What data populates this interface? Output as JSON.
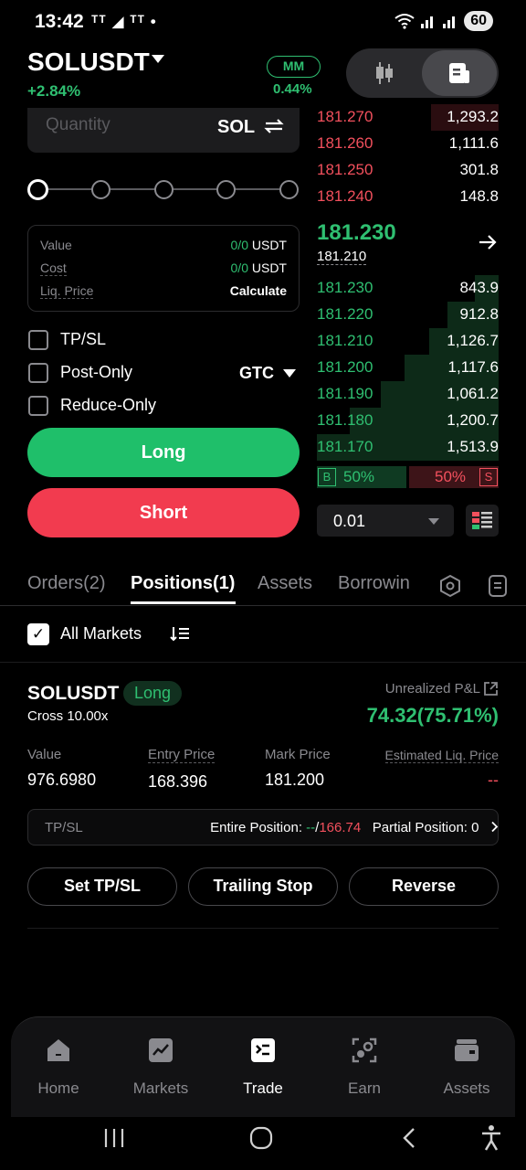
{
  "status_bar": {
    "time": "13:42",
    "apps": "ᵀᵀ ◢ ᵀᵀ •",
    "battery": "60"
  },
  "header": {
    "pair": "SOLUSDT",
    "change": "+2.84%",
    "mm_label": "MM",
    "mm_value": "0.44%"
  },
  "order_form": {
    "quantity_placeholder": "Quantity",
    "quantity_unit": "SOL",
    "value_label": "Value",
    "value": "0/0",
    "value_unit": "USDT",
    "cost_label": "Cost",
    "cost": "0/0",
    "cost_unit": "USDT",
    "liq_label": "Liq. Price",
    "liq_value": "Calculate",
    "tpsl_label": "TP/SL",
    "post_only_label": "Post-Only",
    "reduce_only_label": "Reduce-Only",
    "tif": "GTC",
    "long_label": "Long",
    "short_label": "Short"
  },
  "order_book": {
    "asks": [
      {
        "price": "181.270",
        "qty": "1,293.2",
        "depth": 0.37
      },
      {
        "price": "181.260",
        "qty": "1,111.6",
        "depth": 0.0
      },
      {
        "price": "181.250",
        "qty": "301.8",
        "depth": 0.0
      },
      {
        "price": "181.240",
        "qty": "148.8",
        "depth": 0.0
      }
    ],
    "mid_price": "181.230",
    "mark_price": "181.210",
    "bids": [
      {
        "price": "181.230",
        "qty": "843.9",
        "depth": 0.13
      },
      {
        "price": "181.220",
        "qty": "912.8",
        "depth": 0.28
      },
      {
        "price": "181.210",
        "qty": "1,126.7",
        "depth": 0.38
      },
      {
        "price": "181.200",
        "qty": "1,117.6",
        "depth": 0.52
      },
      {
        "price": "181.190",
        "qty": "1,061.2",
        "depth": 0.65
      },
      {
        "price": "181.180",
        "qty": "1,200.7",
        "depth": 0.82
      },
      {
        "price": "181.170",
        "qty": "1,513.9",
        "depth": 1.0
      }
    ],
    "buy_ratio_badge": "B",
    "buy_ratio": "50%",
    "sell_ratio": "50%",
    "sell_ratio_badge": "S",
    "precision": "0.01"
  },
  "tabs": [
    {
      "label": "Orders(2)"
    },
    {
      "label": "Positions(1)"
    },
    {
      "label": "Assets"
    },
    {
      "label": "Borrowin"
    }
  ],
  "filter": {
    "all_markets": "All Markets",
    "check": "✓"
  },
  "position": {
    "symbol": "SOLUSDT",
    "side": "Long",
    "leverage": "Cross 10.00x",
    "upnl_label": "Unrealized P&L",
    "upnl": "74.32(75.71%)",
    "value_label": "Value",
    "value": "976.6980",
    "entry_label": "Entry Price",
    "entry": "168.396",
    "mark_label": "Mark Price",
    "mark": "181.200",
    "liq_label": "Estimated Liq. Price",
    "liq": "--",
    "tpsl_label": "TP/SL",
    "entire_label": "Entire Position:",
    "entire_tp": "--",
    "entire_sep": "/",
    "entire_sl": "166.74",
    "partial_label": "Partial Position: 0",
    "set_tpsl": "Set TP/SL",
    "trailing": "Trailing Stop",
    "reverse": "Reverse"
  },
  "bottom_nav": [
    {
      "label": "Home"
    },
    {
      "label": "Markets"
    },
    {
      "label": "Trade"
    },
    {
      "label": "Earn"
    },
    {
      "label": "Assets"
    }
  ],
  "colors": {
    "green": "#2fbf71",
    "red": "#f2505d",
    "long": "#1fbf6a",
    "short": "#f23b4f"
  }
}
